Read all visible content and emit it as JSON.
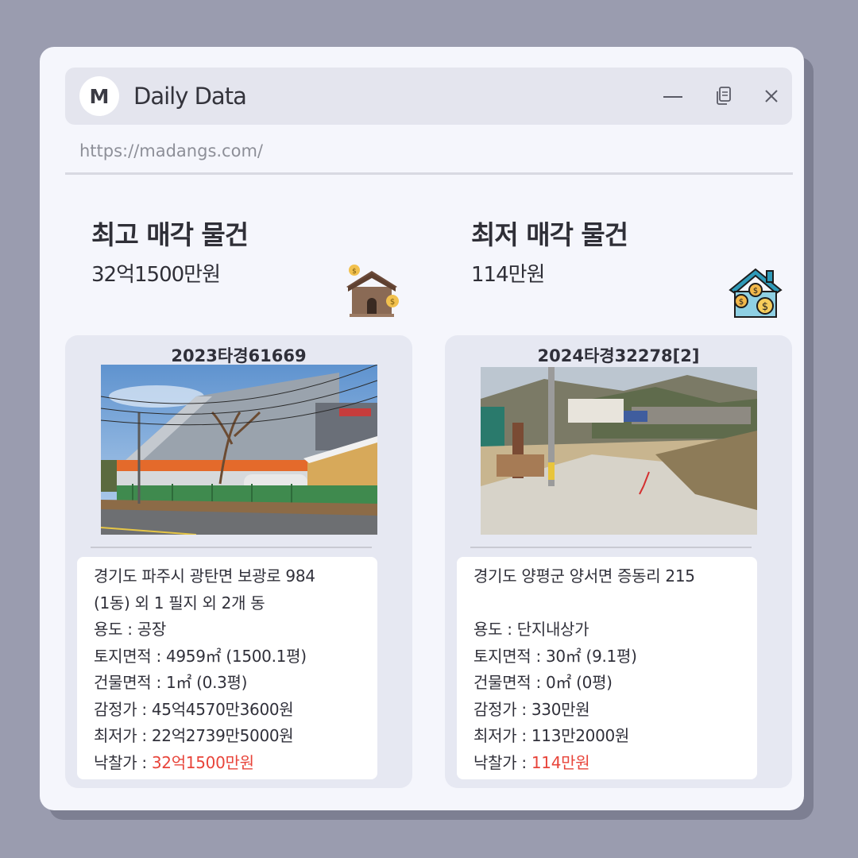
{
  "window": {
    "avatar_letter": "M",
    "title": "Daily Data",
    "url": "https://madangs.com/",
    "controls": [
      "minimize-icon",
      "copy-icon",
      "close-icon"
    ]
  },
  "highest": {
    "heading": "최고 매각 물건",
    "amount": "32억1500만원",
    "case_no": "2023타경61669",
    "address_1": "경기도 파주시 광탄면 보광로 984",
    "address_2": "(1동) 외 1 필지 외 2개 동",
    "usage": "용도 : 공장",
    "land_area": "토지면적 : 4959㎡ (1500.1평)",
    "building_area": "건물면적 : 1㎡ (0.3평)",
    "appraised": "감정가 : 45억4570만3600원",
    "minimum": "최저가 : 22억2739만5000원",
    "winning_label": "낙찰가 : ",
    "winning_value": "32억1500만원"
  },
  "lowest": {
    "heading": "최저 매각 물건",
    "amount": "114만원",
    "case_no": "2024타경32278[2]",
    "address_1": "경기도 양평군 양서면 증동리 215",
    "address_2": "",
    "usage": "용도 :  단지내상가",
    "land_area": "토지면적 : 30㎡ (9.1평)",
    "building_area": "건물면적 : 0㎡ (0평)",
    "appraised": "감정가 : 330만원",
    "minimum": "최저가 : 113만2000원",
    "winning_label": "낙찰가 : ",
    "winning_value": "114만원"
  },
  "colors": {
    "background": "#9a9caf",
    "window": "#f5f6fc",
    "titlebar": "#e4e5ee",
    "card": "#e6e8f2",
    "accent_red": "#e8443a"
  }
}
